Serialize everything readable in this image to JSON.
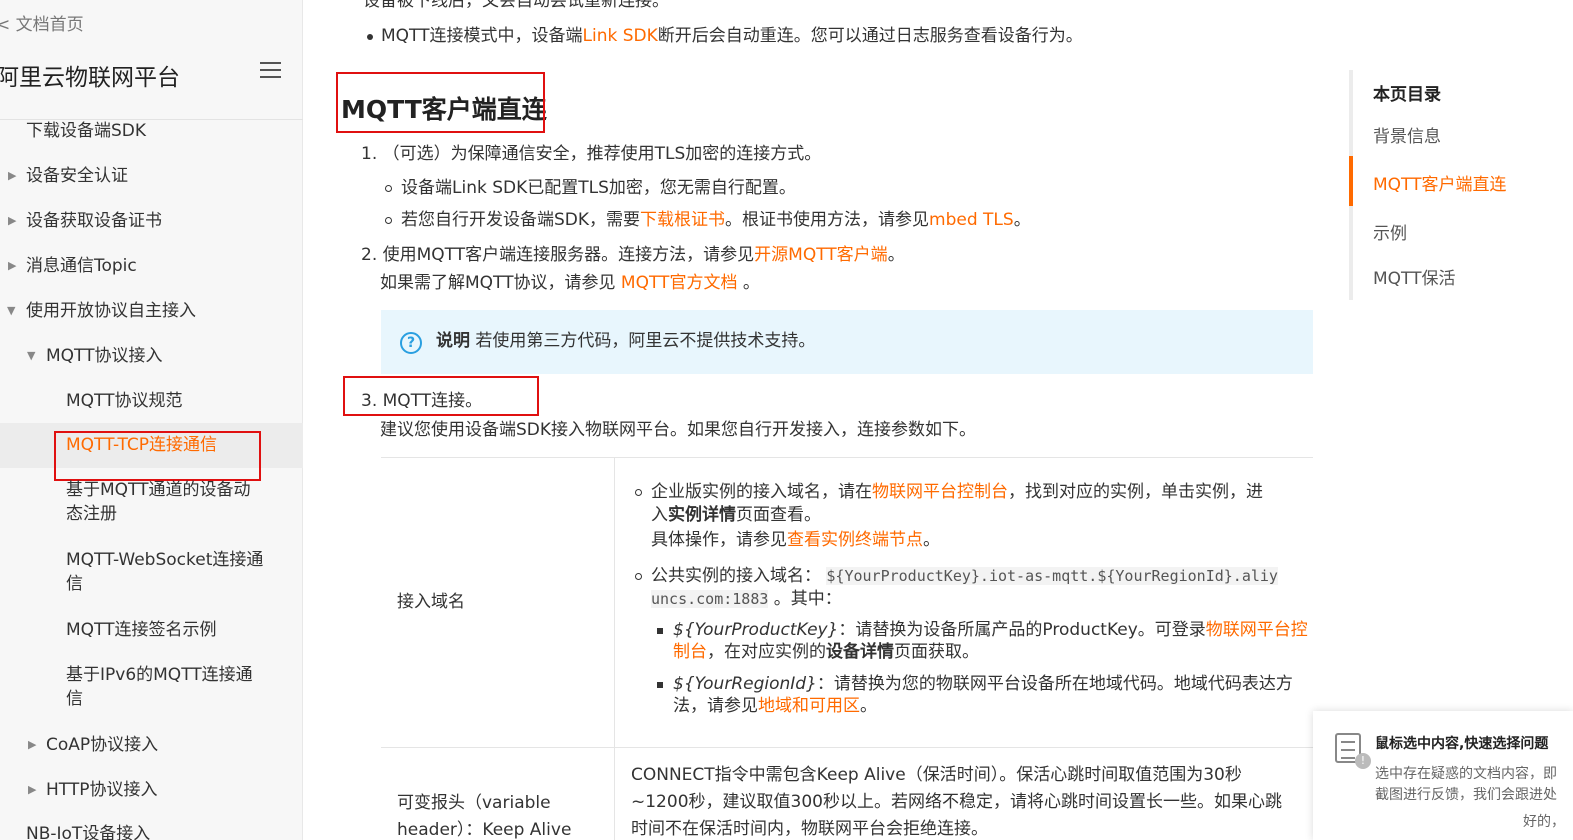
{
  "sidebar": {
    "crumb": "< 文档首页",
    "brand": "阿里云物联网平台",
    "items": [
      "下载设备端SDK",
      "设备安全认证",
      "设备获取设备证书",
      "消息通信Topic",
      "使用开放协议自主接入",
      "MQTT协议接入",
      "MQTT协议规范",
      "MQTT-TCP连接通信",
      "基于MQTT通道的设备动",
      "态注册",
      "MQTT-WebSocket连接通",
      "信",
      "MQTT连接签名示例",
      "基于IPv6的MQTT连接通",
      "信",
      "CoAP协议接入",
      "HTTP协议接入",
      "NB-IoT设备接入"
    ]
  },
  "content": {
    "top_cut": "设备被下线后，又会自动尝试重新连接。",
    "bullet1_a": "MQTT连接模式中，设备端",
    "bullet1_link": "Link SDK",
    "bullet1_b": "断开后会自动重连。您可以通过日志服务查看设备行为。",
    "heading": "MQTT客户端直连",
    "s1": "1. （可选）为保障通信安全，推荐使用TLS加密的连接方式。",
    "s1a": "设备端Link SDK已配置TLS加密，您无需自行配置。",
    "s1b_a": "若您自行开发设备端SDK，需要",
    "s1b_link": "下载根证书",
    "s1b_b": "。根证书使用方法，请参见",
    "s1b_link2": "mbed TLS",
    "s1b_c": "。",
    "s2_a": "2. 使用MQTT客户端连接服务器。连接方法，请参见",
    "s2_link": "开源MQTT客户端",
    "s2_b": "。",
    "s2_line2_a": "如果需了解MQTT协议，请参见 ",
    "s2_line2_link": "MQTT官方文档",
    "s2_line2_b": " 。",
    "note_label": "说明",
    "note_text": "若使用第三方代码，阿里云不提供技术支持。",
    "s3": "3. MQTT连接。",
    "s3_line2": "建议您使用设备端SDK接入物联网平台。如果您自行开发接入，连接参数如下。",
    "row1_label": "接入域名",
    "r1_a1": "企业版实例的接入域名，请在",
    "r1_link1": "物联网平台控制台",
    "r1_a2": "，找到对应的实例，单击实例，进",
    "r1_b1": "入",
    "r1_b_bold": "实例详情",
    "r1_b2": "页面查看。",
    "r1_c1": "具体操作，请参见",
    "r1_c_link": "查看实例终端节点",
    "r1_c2": "。",
    "r1_d1": "公共实例的接入域名：",
    "r1_code1": "${YourProductKey}.iot-as-mqtt.${YourRegionId}.aliy",
    "r1_code2": "uncs.com:1883",
    "r1_d2": " 。其中：",
    "r1_e_it": "${YourProductKey}",
    "r1_e1": "：请替换为设备所属产品的ProductKey。可登录",
    "r1_e_link": "物联网平台控",
    "r1_f_link": "制台",
    "r1_f1": "，在对应实例的",
    "r1_f_bold": "设备详情",
    "r1_f2": "页面获取。",
    "r1_g_it": "${YourRegionId}",
    "r1_g1": "：请替换为您的物联网平台设备所在地域代码。地域代码表达方",
    "r1_h1": "法，请参见",
    "r1_h_link": "地域和可用区",
    "r1_h2": "。",
    "row2_label1": "可变报头（variable",
    "row2_label2": "header）：Keep Alive",
    "r2_l1": "CONNECT指令中需包含Keep Alive（保活时间）。保活心跳时间取值范围为30秒",
    "r2_l2": "~1200秒，建议取值300秒以上。若网络不稳定，请将心跳时间设置长一些。如果心跳",
    "r2_l3": "时间不在保活时间内，物联网平台会拒绝连接。"
  },
  "toc": {
    "title": "本页目录",
    "items": [
      "背景信息",
      "MQTT客户端直连",
      "示例",
      "MQTT保活"
    ]
  },
  "feedback": {
    "title": "鼠标选中内容,快速选择问题",
    "line1": "选中存在疑惑的文档内容，即",
    "line2": "截图进行反馈，我们会跟进处",
    "line3": "好的，"
  },
  "colors": {
    "accent": "#ff6a00",
    "highlight_box": "#e01010",
    "note_bg": "#e8f6fd"
  }
}
